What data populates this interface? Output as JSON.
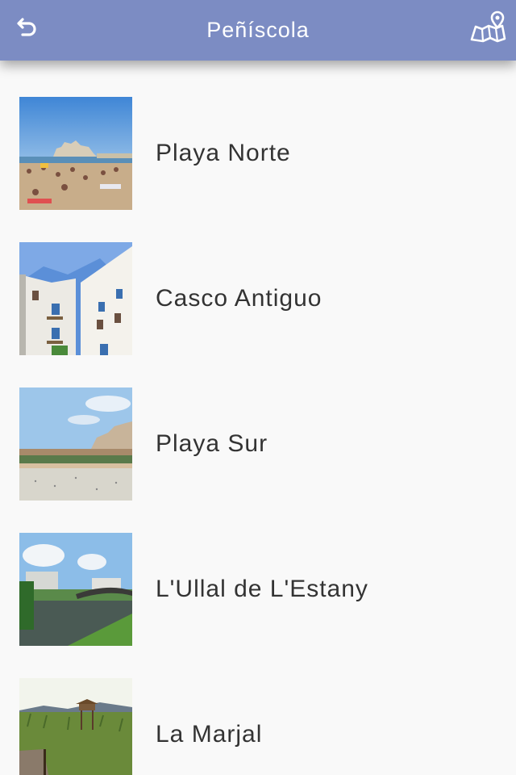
{
  "header": {
    "title": "Peñíscola",
    "back_icon": "back-arrow-icon",
    "map_icon": "map-pin-icon",
    "color": "#7c8cc3"
  },
  "places": [
    {
      "name": "Playa Norte"
    },
    {
      "name": "Casco Antiguo"
    },
    {
      "name": "Playa Sur"
    },
    {
      "name": "L'Ullal de L'Estany"
    },
    {
      "name": "La Marjal"
    }
  ]
}
